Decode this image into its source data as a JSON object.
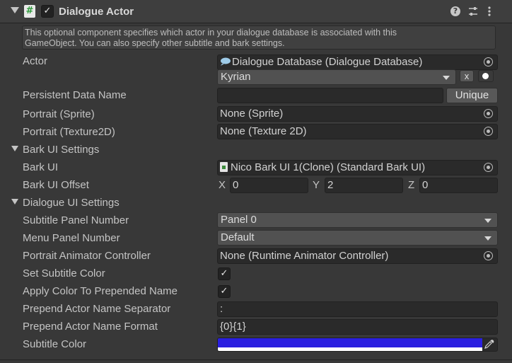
{
  "header": {
    "title": "Dialogue Actor",
    "enabled": true,
    "icons": [
      "script-icon",
      "help-icon",
      "presets-icon",
      "kebab-menu-icon"
    ]
  },
  "help": {
    "line1": "This optional component specifies which actor in your dialogue database is associated with this",
    "line2": "GameObject. You can also specify other subtitle and bark settings."
  },
  "actor": {
    "label": "Actor",
    "database": "Dialogue Database (Dialogue Database)",
    "selected": "Kyrian",
    "clear_label": "x"
  },
  "persistent": {
    "label": "Persistent Data Name",
    "value": "",
    "button": "Unique"
  },
  "portrait_sprite": {
    "label": "Portrait (Sprite)",
    "value": "None (Sprite)"
  },
  "portrait_texture": {
    "label": "Portrait (Texture2D)",
    "value": "None (Texture 2D)"
  },
  "bark": {
    "section": "Bark UI Settings",
    "ui_label": "Bark UI",
    "ui_value": "Nico Bark UI 1(Clone) (Standard Bark UI)",
    "offset_label": "Bark UI Offset",
    "x_label": "X",
    "x": "0",
    "y_label": "Y",
    "y": "2",
    "z_label": "Z",
    "z": "0"
  },
  "dialogue": {
    "section": "Dialogue UI Settings",
    "subtitle_panel_label": "Subtitle Panel Number",
    "subtitle_panel_value": "Panel 0",
    "menu_panel_label": "Menu Panel Number",
    "menu_panel_value": "Default",
    "animator_label": "Portrait Animator Controller",
    "animator_value": "None (Runtime Animator Controller)",
    "set_color_label": "Set Subtitle Color",
    "set_color": true,
    "apply_color_label": "Apply Color To Prepended Name",
    "apply_color": true,
    "separator_label": "Prepend Actor Name Separator",
    "separator_value": ":",
    "format_label": "Prepend Actor Name Format",
    "format_value": "{0}{1}",
    "subtitle_color_label": "Subtitle Color",
    "subtitle_color": "#2a1fe0"
  }
}
